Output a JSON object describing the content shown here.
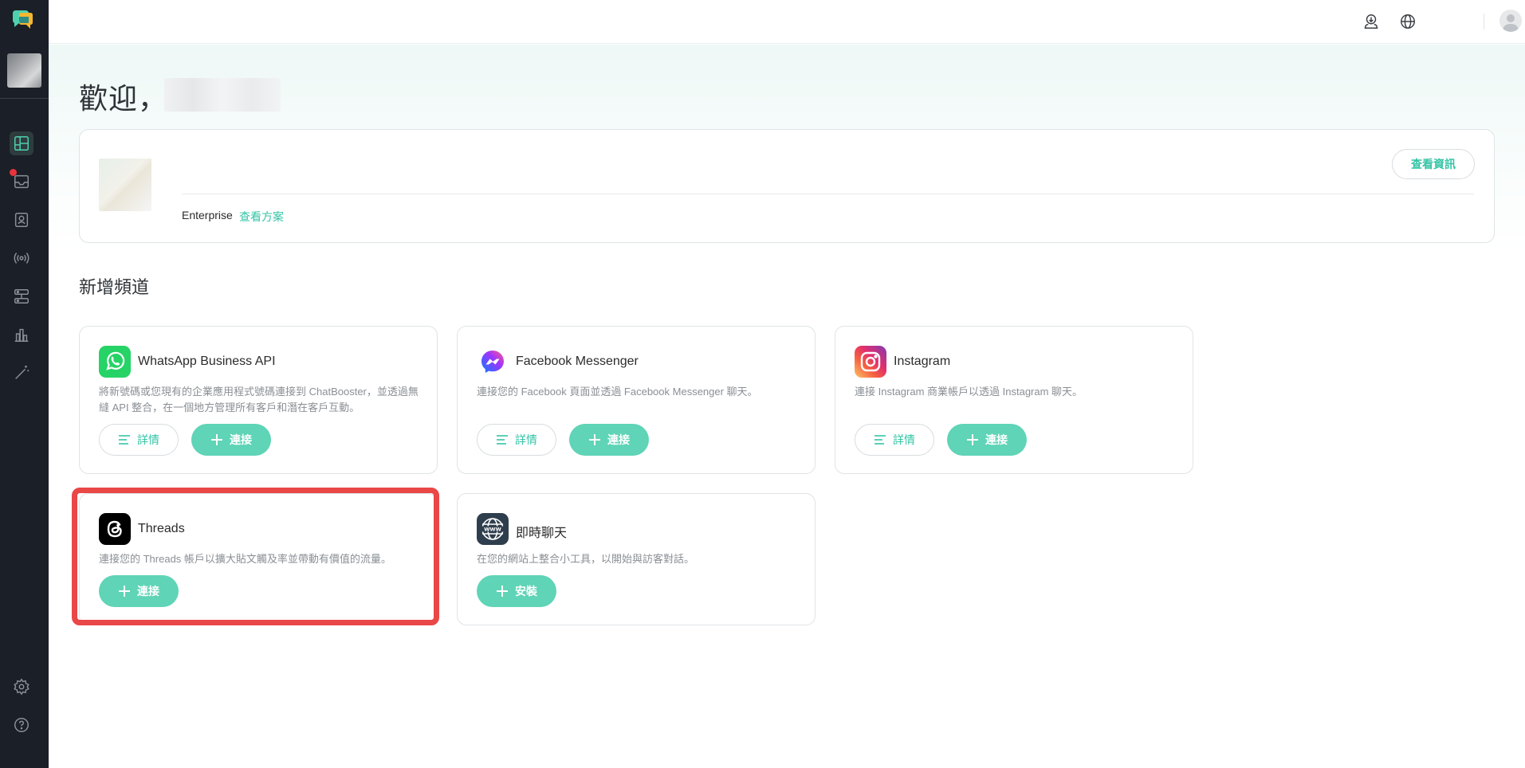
{
  "header": {
    "welcome": "歡迎，"
  },
  "org": {
    "plan": "Enterprise",
    "plan_link": "查看方案",
    "view_info": "查看資訊"
  },
  "section": {
    "title": "新增頻道"
  },
  "channels": [
    {
      "name": "WhatsApp Business API",
      "desc": "將新號碼或您現有的企業應用程式號碼連接到 ChatBooster，並透過無縫 API 整合，在一個地方管理所有客戶和潛在客戶互動。",
      "detail": "詳情",
      "action": "連接",
      "icon": "whatsapp-icon"
    },
    {
      "name": "Facebook Messenger",
      "desc": "連接您的 Facebook 頁面並透過 Facebook Messenger 聊天。",
      "detail": "詳情",
      "action": "連接",
      "icon": "messenger-icon"
    },
    {
      "name": "Instagram",
      "desc": "連接 Instagram 商業帳戶以透過 Instagram 聊天。",
      "detail": "詳情",
      "action": "連接",
      "icon": "instagram-icon"
    },
    {
      "name": "Threads",
      "desc": "連接您的 Threads 帳戶以擴大貼文觸及率並帶動有價值的流量。",
      "action": "連接",
      "icon": "threads-icon"
    },
    {
      "name": "即時聊天",
      "desc": "在您的網站上整合小工具，以開始與訪客對話。",
      "action": "安裝",
      "icon": "www-globe-icon"
    }
  ],
  "colors": {
    "accent": "#34c4a5",
    "button_fill": "#5fd4b6",
    "sidebar": "#1b1f27",
    "highlight": "#ea4747",
    "notification": "#e8333d"
  }
}
